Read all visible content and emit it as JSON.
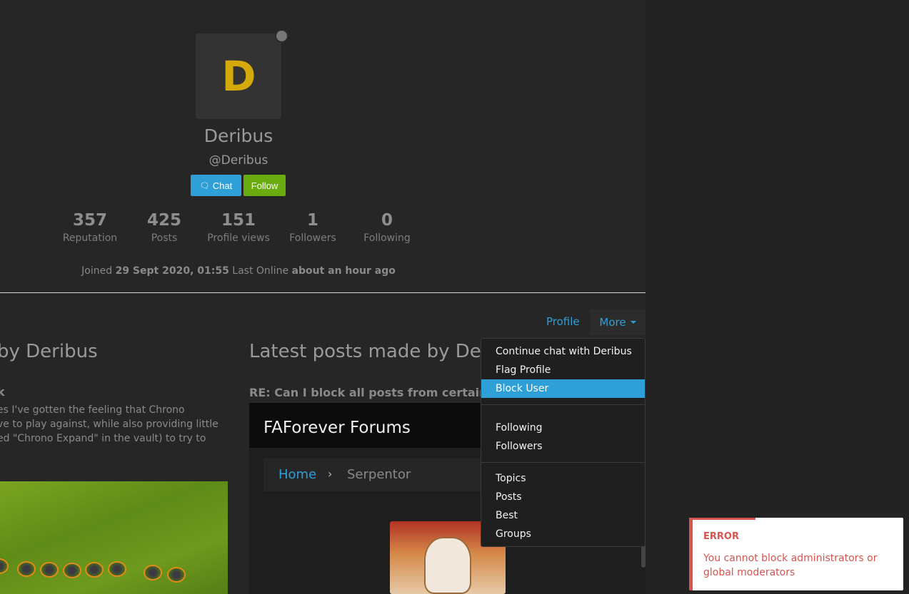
{
  "profile": {
    "avatar_letter": "D",
    "display_name": "Deribus",
    "username": "@Deribus",
    "chat_label": "Chat",
    "follow_label": "Follow"
  },
  "stats": [
    {
      "value": "357",
      "label": "Reputation"
    },
    {
      "value": "425",
      "label": "Posts"
    },
    {
      "value": "151",
      "label": "Profile views"
    },
    {
      "value": "1",
      "label": "Followers"
    },
    {
      "value": "0",
      "label": "Following"
    }
  ],
  "joined": {
    "joined_prefix": "Joined",
    "joined_date": "29 Sept 2020, 01:55",
    "online_prefix": "Last Online",
    "online_value": "about an hour ago"
  },
  "tabs": {
    "profile": "Profile",
    "more": "More"
  },
  "left_column": {
    "heading": "by Deribus",
    "topic_fragment": "k",
    "excerpt_lines": [
      "es I've gotten the feeling that Chrono",
      "ve to play against, while also providing little",
      "ed \"Chrono Expand\" in the vault) to try to"
    ]
  },
  "right_column": {
    "heading": "Latest posts made by Deribus",
    "post_title": "RE: Can I block all posts from certain users?"
  },
  "embed": {
    "title": "FAForever Forums",
    "crumb_home": "Home",
    "crumb_sep": "›",
    "crumb_current": "Serpentor"
  },
  "dropdown": {
    "items": [
      "Continue chat with Deribus",
      "Flag Profile",
      "Block User",
      "Following",
      "Followers",
      "Topics",
      "Posts",
      "Best",
      "Groups"
    ],
    "active_index": 2
  },
  "toast": {
    "title": "ERROR",
    "message": "You cannot block administrators or global moderators"
  },
  "colors": {
    "accent": "#2f9fd8",
    "follow_green": "#6aab10",
    "error_red": "#d9534f",
    "avatar_gold": "#d4a90a"
  }
}
